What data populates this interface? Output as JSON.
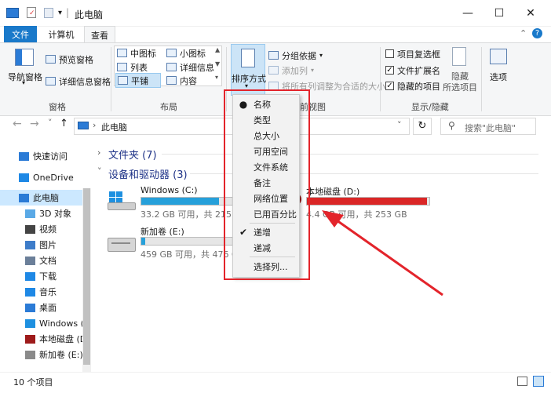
{
  "title_bar": {
    "title": "此电脑",
    "pipe": "|",
    "minimize_glyph": "—",
    "maximize_glyph": "☐",
    "close_glyph": "✕"
  },
  "ribbon_tabs": [
    {
      "label": "文件"
    },
    {
      "label": "计算机"
    },
    {
      "label": "查看"
    }
  ],
  "ribbon_right": {
    "collapse_glyph": "⌃",
    "help_glyph": "?"
  },
  "ribbon": {
    "pane_group": {
      "nav_pane_label": "导航窗格",
      "preview_pane_label": "预览窗格",
      "details_pane_label": "详细信息窗格",
      "group_label": "窗格"
    },
    "layout_group": {
      "items": [
        "中图标",
        "小图标",
        "列表",
        "详细信息",
        "平铺",
        "内容"
      ],
      "group_label": "布局"
    },
    "current_view_group": {
      "sort_by_label": "排序方式",
      "group_by_label": "分组依据",
      "add_column_label": "添加列",
      "fit_columns_label": "将所有列调整为合适的大小",
      "group_label": "当前视图",
      "group_label_visible": "前视图"
    },
    "show_hide_group": {
      "item_checkboxes": {
        "label": "项目复选框",
        "checked": false
      },
      "file_extensions": {
        "label": "文件扩展名",
        "checked": true
      },
      "hidden_items": {
        "label": "隐藏的项目",
        "checked": true
      },
      "hide_selected_label": "隐藏",
      "hide_selected_sub": "所选项目",
      "options_label": "选项",
      "group_label": "显示/隐藏"
    }
  },
  "address_bar": {
    "back_glyph": "←",
    "forward_glyph": "→",
    "recent_glyph": "˅",
    "up_glyph": "↑",
    "path_sep": "›",
    "path": "此电脑",
    "dropdown_glyph": "˅",
    "refresh_glyph": "↻",
    "search_placeholder": "搜索\"此电脑\""
  },
  "nav_pane": {
    "items": [
      {
        "label": "快速访问",
        "icon": "star-icon"
      },
      {
        "label": "OneDrive",
        "icon": "cloud-icon"
      },
      {
        "label": "此电脑",
        "icon": "computer-icon",
        "selected": true
      },
      {
        "label": "3D 对象",
        "icon": "cube-icon"
      },
      {
        "label": "视频",
        "icon": "video-icon"
      },
      {
        "label": "图片",
        "icon": "picture-icon"
      },
      {
        "label": "文档",
        "icon": "document-icon"
      },
      {
        "label": "下载",
        "icon": "download-icon"
      },
      {
        "label": "音乐",
        "icon": "music-icon"
      },
      {
        "label": "桌面",
        "icon": "desktop-icon"
      },
      {
        "label": "Windows (C",
        "icon": "windows-drive-icon"
      },
      {
        "label": "本地磁盘 (D",
        "icon": "disk-icon"
      },
      {
        "label": "新加卷 (E:)",
        "icon": "disk-icon"
      }
    ]
  },
  "content": {
    "folders_section": "文件夹 (7)",
    "drives_section": "设备和驱动器 (3)",
    "drives": [
      {
        "name": "Windows (C:)",
        "info": "33.2 GB 可用，共 215",
        "usage": 0.85
      },
      {
        "name": "本地磁盘 (D:)",
        "info": "4.4 GB 可用，共 253 GB",
        "usage": 0.98
      },
      {
        "name": "新加卷 (E:)",
        "info": "459 GB 可用，共 476 GB",
        "usage": 0.04
      }
    ],
    "c_info_fragment": "G"
  },
  "status_bar": {
    "count": "10 个项目"
  },
  "sort_menu": {
    "items": [
      {
        "label": "名称",
        "mark": "●"
      },
      {
        "label": "类型",
        "mark": ""
      },
      {
        "label": "总大小",
        "mark": ""
      },
      {
        "label": "可用空间",
        "mark": ""
      },
      {
        "label": "文件系统",
        "mark": ""
      },
      {
        "label": "备注",
        "mark": ""
      },
      {
        "label": "网络位置",
        "mark": ""
      },
      {
        "label": "已用百分比",
        "mark": ""
      }
    ],
    "order_items": [
      {
        "label": "递增",
        "mark": "✔"
      },
      {
        "label": "递减",
        "mark": ""
      }
    ],
    "choose_columns": "选择列..."
  },
  "colors": {
    "accent": "#1979ca",
    "annotation_red": "#e3242b",
    "drive_fill": "#26a0da",
    "drive_full": "#da2626"
  }
}
